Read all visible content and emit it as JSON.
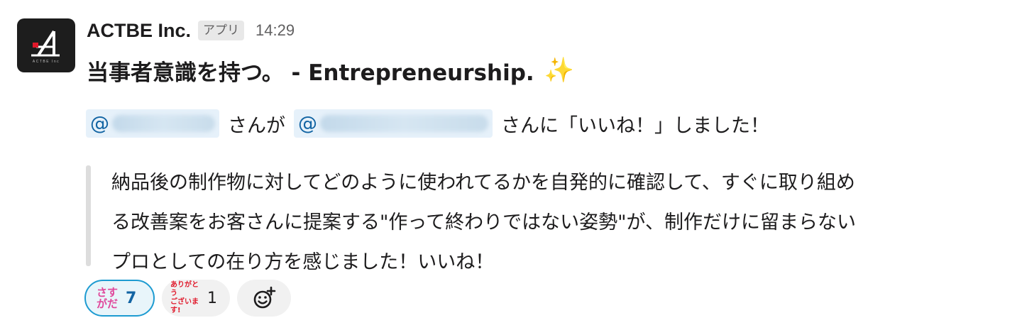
{
  "message": {
    "sender": "ACTBE Inc.",
    "app_badge": "アプリ",
    "timestamp": "14:29",
    "avatar_caption": "ACTBE Inc",
    "title": "当事者意識を持つ。 - Entrepreneurship.",
    "title_emoji": "✨",
    "mention_prefix_1": "@",
    "connector_1": "さんが",
    "mention_prefix_2": "@",
    "connector_2": "さんに「いいね！」しました！",
    "quote_lines": [
      "納品後の制作物に対してどのように使われてるかを自発的に確認して、すぐに取り組め",
      "る改善案をお客さんに提案する\"作って終わりではない姿勢\"が、制作だけに留まらない",
      "プロとしての在り方を感じました！いいね！"
    ]
  },
  "reactions": [
    {
      "emoji_lines": [
        "さす",
        "がだ"
      ],
      "count": "7"
    },
    {
      "emoji_lines": [
        "ありがとう",
        "ございます!"
      ],
      "count": "1"
    }
  ],
  "colors": {
    "mention_bg": "#e6f1fa",
    "mention_text": "#1264a3",
    "active_reaction_border": "#1d9bd1"
  },
  "icons": {
    "add_reaction": "add-reaction-icon",
    "sparkle": "sparkles-icon"
  }
}
